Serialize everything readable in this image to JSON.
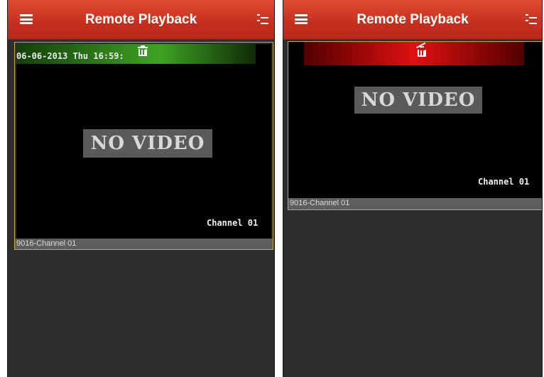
{
  "screens": [
    {
      "title": "Remote Playback",
      "osd_timestamp": "06-06-2013 Thu 16:59:",
      "no_video_text": "NO VIDEO",
      "channel_overlay": "Channel 01",
      "label": "9016-Channel 01",
      "delete_bar_color": "#3fa324"
    },
    {
      "title": "Remote Playback",
      "no_video_text": "NO VIDEO",
      "channel_overlay": "Channel 01",
      "label": "9016-Channel 01",
      "delete_bar_color": "#e01010"
    }
  ],
  "colors": {
    "titlebar": "#c62f1d",
    "background": "#2e2e2e",
    "selected_border": "#c9a93a"
  },
  "icons": [
    "menu-icon",
    "list-icon",
    "trash-icon"
  ]
}
